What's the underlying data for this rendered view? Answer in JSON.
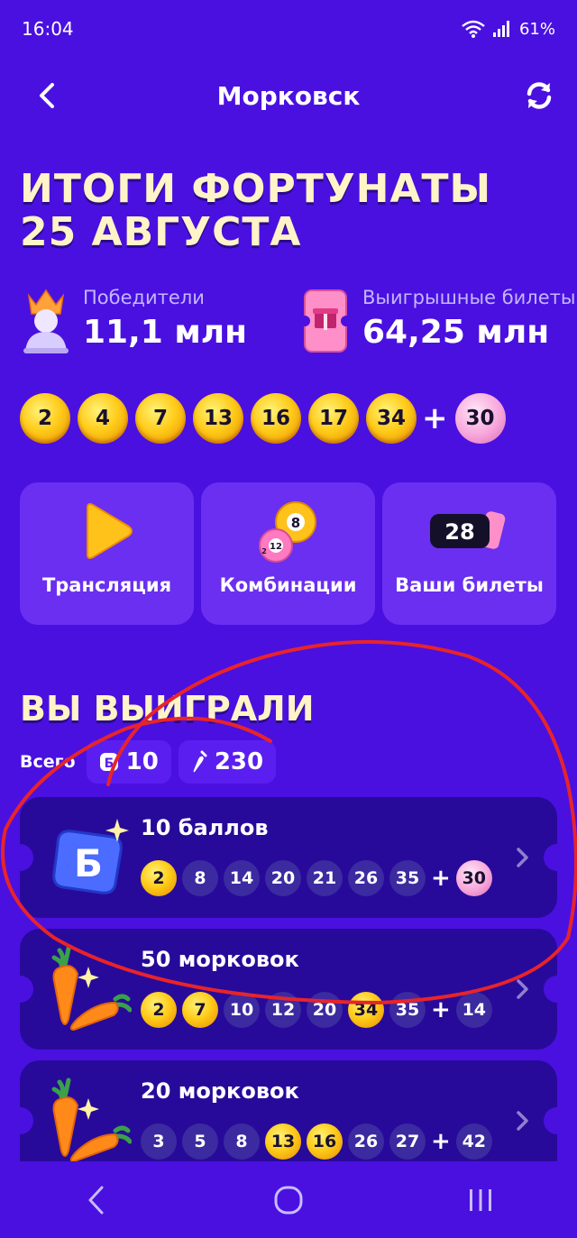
{
  "status_bar": {
    "time": "16:04",
    "battery": "61%"
  },
  "header": {
    "title": "Морковск"
  },
  "heading": {
    "line1": "ИТОГИ ФОРТУНАТЫ",
    "line2": "25 АВГУСТА"
  },
  "stats": [
    {
      "label": "Победители",
      "value": "11,1 млн"
    },
    {
      "label": "Выигрышные билеты",
      "value": "64,25 млн"
    }
  ],
  "draw": {
    "main": [
      "2",
      "4",
      "7",
      "13",
      "16",
      "17",
      "34"
    ],
    "plus": "+",
    "bonus": "30"
  },
  "tiles": [
    {
      "label": "Трансляция"
    },
    {
      "label": "Комбинации"
    },
    {
      "label": "Ваши билеты",
      "badge": "28"
    }
  ],
  "combo_icon": {
    "ball_a": "8",
    "ball_b": "12",
    "ball_b2": "2"
  },
  "winnings": {
    "title": "ВЫ ВЫИГРАЛИ",
    "totals_label": "Всего",
    "points_total": "10",
    "carrots_total": "230",
    "points_glyph": "Б"
  },
  "tickets": [
    {
      "title": "10 баллов",
      "balls": [
        "2",
        "8",
        "14",
        "20",
        "21",
        "26",
        "35"
      ],
      "bonus": "30",
      "gold": [
        0
      ],
      "bonus_hit": true
    },
    {
      "title": "50 морковок",
      "balls": [
        "2",
        "7",
        "10",
        "12",
        "20",
        "34",
        "35"
      ],
      "bonus": "14",
      "gold": [
        0,
        1,
        5
      ],
      "bonus_hit": false
    },
    {
      "title": "20 морковок",
      "balls": [
        "3",
        "5",
        "8",
        "13",
        "16",
        "26",
        "27"
      ],
      "bonus": "42",
      "gold": [
        3,
        4
      ],
      "bonus_hit": false
    }
  ],
  "colors": {
    "background": "#4a10e0",
    "tile": "#6a2ff0",
    "ticket": "#280a9a",
    "ball_gold": "#ffcc1a",
    "ball_pink": "#f7a6db",
    "annotation": "#e8242a"
  }
}
